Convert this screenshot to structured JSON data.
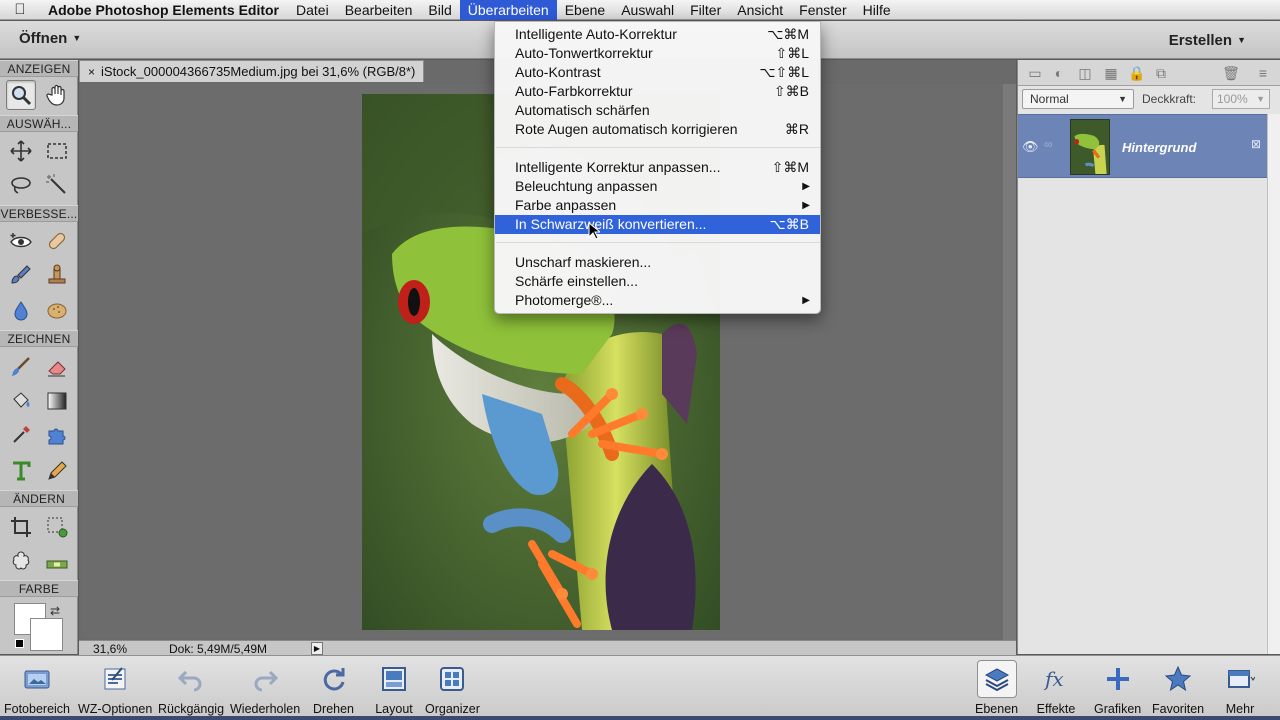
{
  "menubar": {
    "app_name": "Adobe Photoshop Elements Editor",
    "items": [
      "Datei",
      "Bearbeiten",
      "Bild",
      "Überarbeiten",
      "Ebene",
      "Auswahl",
      "Filter",
      "Ansicht",
      "Fenster",
      "Hilfe"
    ],
    "active_index": 3
  },
  "optbar": {
    "open_label": "Öffnen",
    "create_label": "Erstellen"
  },
  "toolbox": {
    "sections": [
      "ANZEIGEN",
      "AUSWÄH...",
      "VERBESSE...",
      "ZEICHNEN",
      "ÄNDERN",
      "FARBE"
    ]
  },
  "document": {
    "tab_title": "iStock_000004366735Medium.jpg bei 31,6% (RGB/8*)",
    "close_glyph": "×",
    "zoom": "31,6%",
    "doc_size": "Dok: 5,49M/5,49M"
  },
  "menu": {
    "items": [
      {
        "label": "Intelligente Auto-Korrektur",
        "shortcut": "⌥⌘M"
      },
      {
        "label": "Auto-Tonwertkorrektur",
        "shortcut": "⇧⌘L"
      },
      {
        "label": "Auto-Kontrast",
        "shortcut": "⌥⇧⌘L"
      },
      {
        "label": "Auto-Farbkorrektur",
        "shortcut": "⇧⌘B"
      },
      {
        "label": "Automatisch schärfen",
        "shortcut": ""
      },
      {
        "label": "Rote Augen automatisch korrigieren",
        "shortcut": "⌘R"
      },
      {
        "label": "Intelligente Korrektur anpassen...",
        "shortcut": "⇧⌘M"
      },
      {
        "label": "Beleuchtung anpassen",
        "shortcut": ""
      },
      {
        "label": "Farbe anpassen",
        "shortcut": ""
      },
      {
        "label": "In Schwarzweiß konvertieren...",
        "shortcut": "⌥⌘B"
      },
      {
        "label": "Unscharf maskieren...",
        "shortcut": ""
      },
      {
        "label": "Schärfe einstellen...",
        "shortcut": ""
      },
      {
        "label": "Photomerge®...",
        "shortcut": ""
      }
    ],
    "highlighted_index": 9
  },
  "layers": {
    "blend_mode": "Normal",
    "opacity_label": "Deckkraft:",
    "opacity_value": "100%",
    "layer_name": "Hintergrund"
  },
  "taskbar": {
    "left": [
      "Fotobereich",
      "WZ-Optionen",
      "Rückgängig",
      "Wiederholen",
      "Drehen",
      "Layout",
      "Organizer"
    ],
    "right": [
      "Ebenen",
      "Effekte",
      "Grafiken",
      "Favoriten",
      "Mehr"
    ]
  },
  "colors": {
    "menu_highlight": "#3063d9",
    "layer_selected": "#6c84b6"
  }
}
